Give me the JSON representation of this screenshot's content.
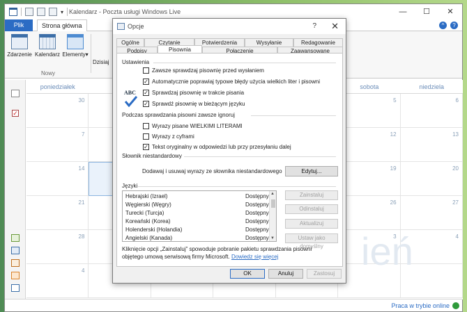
{
  "window": {
    "title": "Kalendarz - Poczta usługi Windows Live",
    "minimize_glyph": "—",
    "maximize_glyph": "☐",
    "close_glyph": "✕"
  },
  "ribbon": {
    "tab_file": "Plik",
    "tab_home": "Strona główna",
    "btn_event": "Zdarzenie",
    "btn_calendar": "Kalendarz",
    "btn_items": "Elementy",
    "group_new": "Nowy",
    "btn_today": "Dzisiaj",
    "help_glyph": "?"
  },
  "calendar": {
    "days": [
      "poniedziałek",
      "",
      "",
      "",
      "",
      "sobota",
      "niedziela"
    ],
    "weeks": [
      [
        "30",
        "",
        "",
        "",
        "",
        "5",
        "6"
      ],
      [
        "7",
        "",
        "",
        "",
        "",
        "12",
        "13"
      ],
      [
        "14",
        "",
        "",
        "",
        "",
        "19",
        "20"
      ],
      [
        "21",
        "",
        "",
        "",
        "",
        "26",
        "27"
      ],
      [
        "28",
        "",
        "",
        "",
        "",
        "3",
        "4"
      ],
      [
        "4",
        "",
        "",
        "",
        "",
        "",
        ""
      ]
    ],
    "watermark": "ień"
  },
  "status": {
    "online": "Praca w trybie online"
  },
  "dialog": {
    "title": "Opcje",
    "help": "?",
    "close": "✕",
    "tabs_top": [
      "Ogólne",
      "Czytanie",
      "Potwierdzenia",
      "Wysyłanie",
      "Redagowanie"
    ],
    "tabs_bottom": [
      "Podpisy",
      "Pisownia",
      "Połączenie",
      "Zaawansowane"
    ],
    "abc_icon_text": "ABC",
    "section_settings": "Ustawienia",
    "settings_checks": [
      {
        "label": "Zawsze sprawdzaj pisownię przed wysłaniem",
        "checked": false
      },
      {
        "label": "Automatycznie poprawiaj typowe błędy użycia wielkich liter i pisowni",
        "checked": true
      },
      {
        "label": "Sprawdzaj pisownię w trakcie pisania",
        "checked": true
      },
      {
        "label": "Sprawdź pisownię w bieżącym języku",
        "checked": true
      }
    ],
    "section_ignore": "Podczas sprawdzania pisowni zawsze ignoruj",
    "ignore_checks": [
      {
        "label": "Wyrazy pisane WIELKIMI LITERAMI",
        "checked": false
      },
      {
        "label": "Wyrazy z cyframi",
        "checked": false
      },
      {
        "label": "Tekst oryginalny w odpowiedzi lub przy przesyłaniu dalej",
        "checked": true
      }
    ],
    "section_dictionary": "Słownik niestandardowy",
    "dictionary_text": "Dodawaj i usuwaj wyrazy ze słownika niestandardowego",
    "edit_button": "Edytuj...",
    "section_languages": "Języki",
    "languages": [
      {
        "name": "Hebrajski (Izrael)",
        "status": "Dostępny"
      },
      {
        "name": "Węgierski (Węgry)",
        "status": "Dostępny"
      },
      {
        "name": "Turecki (Turcja)",
        "status": "Dostępny"
      },
      {
        "name": "Koreański (Korea)",
        "status": "Dostępny"
      },
      {
        "name": "Holenderski (Holandia)",
        "status": "Dostępny"
      },
      {
        "name": "Angielski (Kanada)",
        "status": "Dostępny"
      }
    ],
    "lang_buttons": {
      "install": "Zainstaluj",
      "uninstall": "Odinstaluj",
      "update": "Aktualizuj",
      "set_default": "Ustaw jako domyślny"
    },
    "note_text": "Kliknięcie opcji „Zainstaluj” spowoduje pobranie pakietu sprawdzania pisowni objętego umową serwisową firmy Microsoft.",
    "note_link": "Dowiedz się więcej",
    "ok": "OK",
    "cancel": "Anuluj",
    "apply": "Zastosuj"
  }
}
